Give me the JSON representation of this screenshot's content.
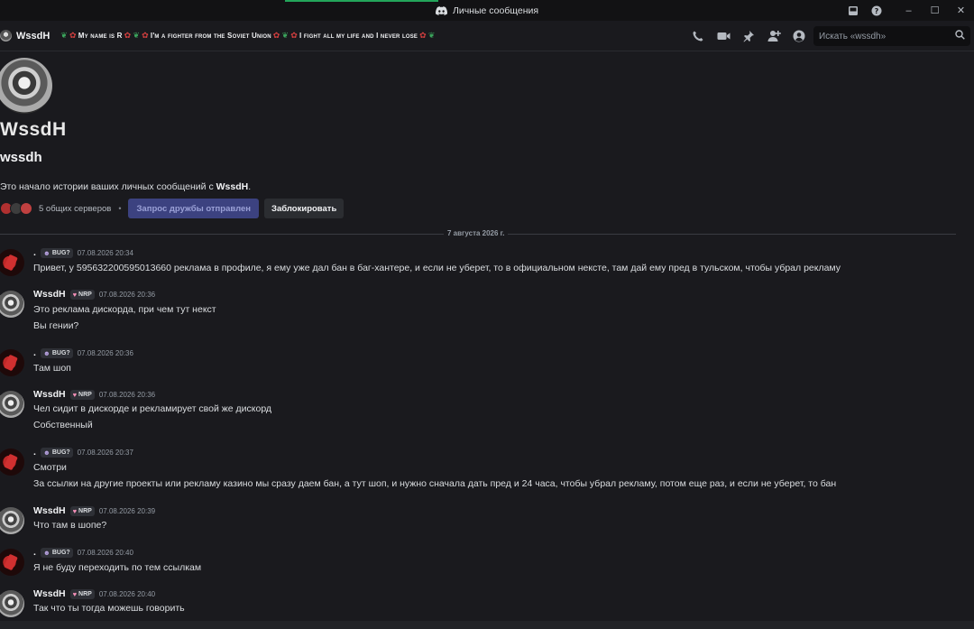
{
  "window": {
    "title": "Личные сообщения",
    "controls": {
      "minimize": "–",
      "maximize": "☐",
      "close": "✕"
    }
  },
  "header": {
    "username": "WssdH",
    "status_parts": [
      "My name is R",
      "I'm a fighter from the Soviet Union",
      "I fight all my life and I never lose"
    ],
    "search_placeholder": "Искать «wssdh»",
    "icons": [
      "call-icon",
      "video-icon",
      "pin-icon",
      "add-friend-icon",
      "profile-icon"
    ]
  },
  "intro": {
    "avatar_logo": "WssdH",
    "username": "wssdh",
    "text_before": "Это начало истории ваших личных сообщений с ",
    "text_name": "WssdH",
    "text_after": ".",
    "mutual_servers": "5 общих серверов",
    "dot": "•",
    "friend_button": "Запрос дружбы отправлен",
    "block_button": "Заблокировать"
  },
  "date_divider": "7 августа 2026 г.",
  "messages": [
    {
      "author": ".",
      "tag": "BUG?",
      "tag_type": "bug",
      "time": "07.08.2026 20:34",
      "lines": [
        "Привет, у 595632200595013660 реклама в профиле, я ему уже дал бан в баг-хантере, и если не уберет, то в официальном нексте, там дай ему пред в тульском, чтобы убрал рекламу"
      ]
    },
    {
      "author": "WssdH",
      "tag": "NRP",
      "tag_type": "nrp",
      "time": "07.08.2026 20:36",
      "lines": [
        "Это реклама дискорда, при чем тут некст",
        "Вы гении?"
      ]
    },
    {
      "author": ".",
      "tag": "BUG?",
      "tag_type": "bug",
      "time": "07.08.2026 20:36",
      "lines": [
        "Там шоп"
      ]
    },
    {
      "author": "WssdH",
      "tag": "NRP",
      "tag_type": "nrp",
      "time": "07.08.2026 20:36",
      "lines": [
        "Чел сидит в дискорде и рекламирует свой же дискорд",
        "Собственный"
      ]
    },
    {
      "author": ".",
      "tag": "BUG?",
      "tag_type": "bug",
      "time": "07.08.2026 20:37",
      "lines": [
        "Смотри",
        "За ссылки на другие проекты или рекламу казино мы сразу даем бан, а тут шоп, и нужно сначала дать пред и 24 часа, чтобы убрал рекламу, потом еще раз, и если не уберет, то бан"
      ]
    },
    {
      "author": "WssdH",
      "tag": "NRP",
      "tag_type": "nrp",
      "time": "07.08.2026 20:39",
      "lines": [
        "Что там в шопе?"
      ]
    },
    {
      "author": ".",
      "tag": "BUG?",
      "tag_type": "bug",
      "time": "07.08.2026 20:40",
      "lines": [
        "Я не буду переходить по тем ссылкам"
      ]
    },
    {
      "author": "WssdH",
      "tag": "NRP",
      "tag_type": "nrp",
      "time": "07.08.2026 20:40",
      "lines": [
        "Так что ты тогда можешь говорить"
      ]
    }
  ]
}
